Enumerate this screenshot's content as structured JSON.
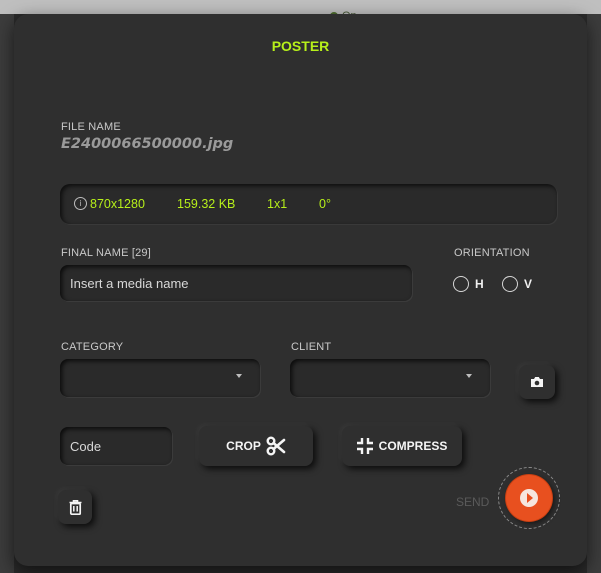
{
  "panel": {
    "title": "POSTER"
  },
  "file": {
    "label": "FILE NAME",
    "name": "E2400066500000.jpg"
  },
  "info": {
    "icon": "info-icon",
    "resolution": "870x1280",
    "size": "159.32 KB",
    "ratio": "1x1",
    "rotation": "0°"
  },
  "final_name": {
    "label": "FINAL NAME [29]",
    "placeholder": "Insert a media name",
    "value": ""
  },
  "orientation": {
    "label": "ORIENTATION",
    "options": [
      "H",
      "V"
    ]
  },
  "category": {
    "label": "CATEGORY",
    "value": ""
  },
  "client": {
    "label": "CLIENT",
    "value": ""
  },
  "code": {
    "placeholder": "Code",
    "value": ""
  },
  "buttons": {
    "crop": "CROP",
    "compress": "COMPRESS",
    "send": "SEND"
  },
  "backdrop": {
    "peek_text": "On"
  },
  "colors": {
    "accent": "#b7f01a",
    "send": "#e8501f",
    "panel": "#2f2f2f"
  }
}
